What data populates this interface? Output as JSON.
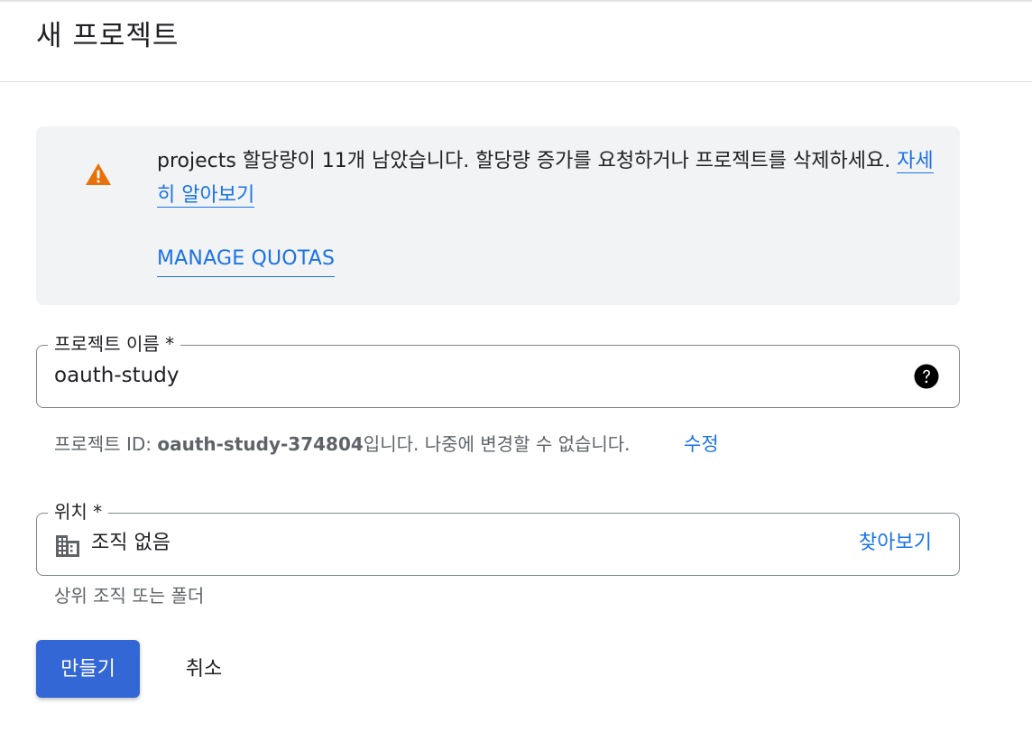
{
  "header": {
    "title": "새 프로젝트"
  },
  "quota_notice": {
    "text": "projects 할당량이 11개 남았습니다. 할당량 증가를 요청하거나 프로젝트를 삭제하세요.",
    "learn_more_label": "자세히 알아보기",
    "manage_quotas_label": "MANAGE QUOTAS",
    "icon": "warning-icon",
    "icon_color": "#e8710a"
  },
  "project_name_field": {
    "label": "프로젝트 이름 *",
    "value": "oauth-study",
    "help_icon": "help-icon"
  },
  "project_id": {
    "prefix": "프로젝트 ID: ",
    "id": "oauth-study-374804",
    "suffix": "입니다. 나중에 변경할 수 없습니다.",
    "edit_label": "수정"
  },
  "location_field": {
    "label": "위치 *",
    "value": "조직 없음",
    "browse_label": "찾아보기",
    "helper_text": "상위 조직 또는 폴더",
    "icon": "building-icon"
  },
  "actions": {
    "create_label": "만들기",
    "cancel_label": "취소"
  },
  "colors": {
    "accent": "#1a73e8",
    "primary_button": "#3367d6",
    "notice_background": "#f1f3f4"
  }
}
